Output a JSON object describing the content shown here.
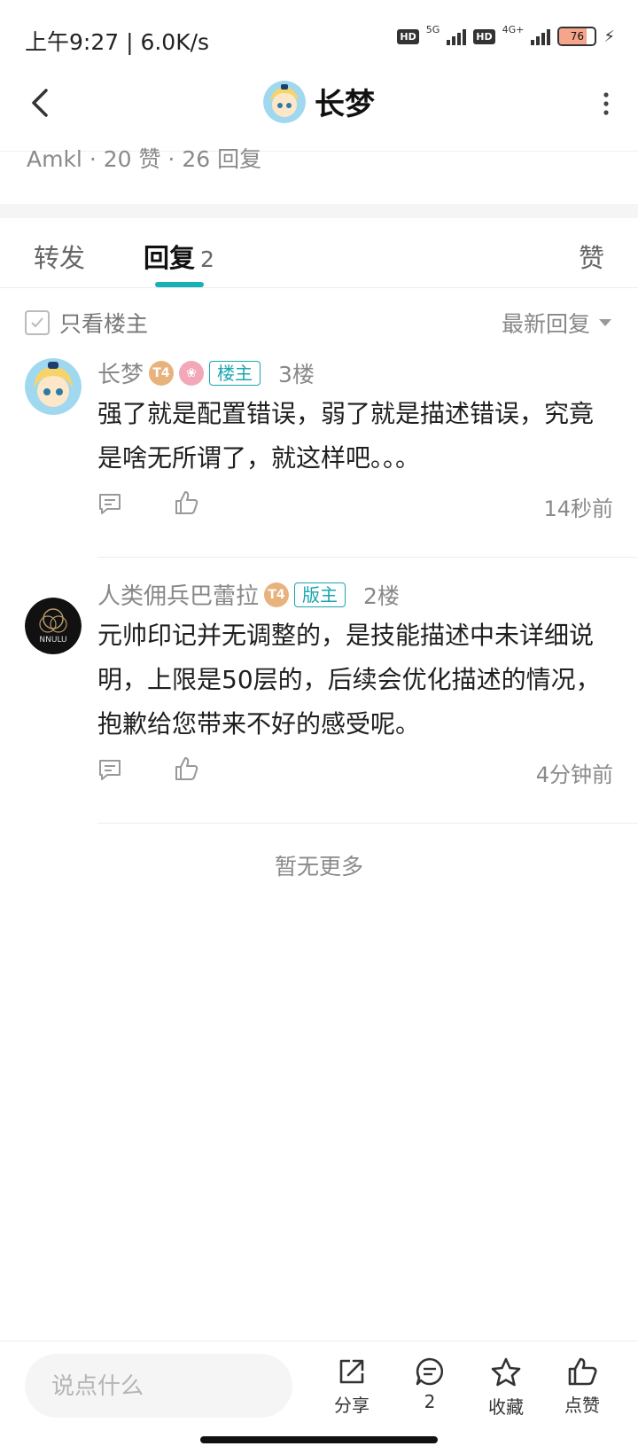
{
  "status_bar": {
    "time": "上午9:27 | 6.0K/s",
    "net1": "5G",
    "net2": "4G+",
    "battery": "76"
  },
  "header": {
    "title": "长梦"
  },
  "post_meta": "Amkl · 20 赞 · 26 回复",
  "tabs": {
    "forward": "转发",
    "reply": "回复",
    "reply_count": "2",
    "like": "赞"
  },
  "filter": {
    "only_op": "只看楼主",
    "sort": "最新回复"
  },
  "comments": [
    {
      "name": "长梦",
      "level": "T4",
      "role": "楼主",
      "floor": "3楼",
      "text": "强了就是配置错误，弱了就是描述错误，究竟是啥无所谓了，就这样吧。。。",
      "time": "14秒前"
    },
    {
      "name": "人类佣兵巴蕾拉",
      "level": "T4",
      "role": "版主",
      "floor": "2楼",
      "text": "元帅印记并无调整的，是技能描述中未详细说明，上限是50层的，后续会优化描述的情况，抱歉给您带来不好的感受呢。",
      "time": "4分钟前"
    }
  ],
  "no_more": "暂无更多",
  "bottom_bar": {
    "input_placeholder": "说点什么",
    "share": "分享",
    "comments": "2",
    "favorite": "收藏",
    "like": "点赞"
  },
  "colors": {
    "accent": "#17b2b8",
    "muted": "#8a8a8a"
  }
}
